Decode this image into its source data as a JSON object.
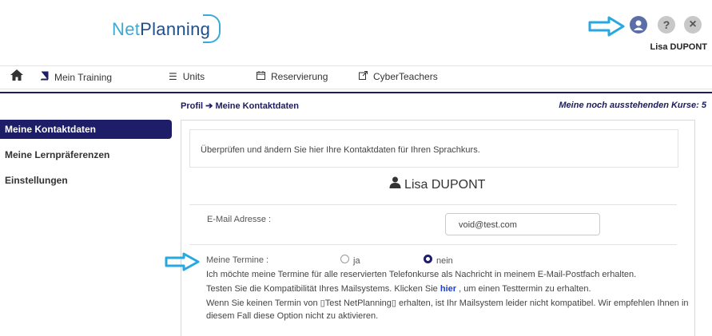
{
  "header": {
    "logo": {
      "part1": "Net",
      "part2": "Planning"
    },
    "username": "Lisa DUPONT",
    "icons": [
      "profile-icon",
      "help-icon",
      "close-icon"
    ]
  },
  "nav": {
    "items": [
      {
        "label": "Mein Training",
        "icon": "book-icon"
      },
      {
        "label": "Units",
        "icon": "list-icon"
      },
      {
        "label": "Reservierung",
        "icon": "calendar-icon"
      },
      {
        "label": "CyberTeachers",
        "icon": "external-link-icon"
      }
    ]
  },
  "breadcrumb": "Profil ➔ Meine Kontaktdaten",
  "pending": "Meine noch ausstehenden Kurse: 5",
  "sidebar": {
    "items": [
      {
        "label": "Meine Kontaktdaten"
      },
      {
        "label": "Meine Lernpräferenzen"
      },
      {
        "label": "Einstellungen"
      }
    ]
  },
  "main": {
    "info": "Überprüfen und ändern Sie hier Ihre Kontaktdaten für Ihren Sprachkurs.",
    "name": "Lisa DUPONT",
    "email_label": "E-Mail Adresse :",
    "email_value": "void@test.com",
    "termine_label": "Meine Termine :",
    "option_ja": "ja",
    "option_nein": "nein",
    "selected": "nein",
    "line1": "Ich möchte meine Termine für alle reservierten Telefonkurse als Nachricht in meinem E-Mail-Postfach erhalten.",
    "line2_pre": "Testen Sie die Kompatibilität Ihres Mailsystems. Klicken Sie ",
    "line2_link": "hier",
    "line2_post": " , um einen Testtermin zu erhalten.",
    "line3": "Wenn Sie keinen Termin von ▯Test NetPlanning▯ erhalten, ist Ihr Mailsystem leider nicht kompatibel. Wir empfehlen Ihnen in",
    "line4": "diesem Fall diese Option nicht zu aktivieren."
  },
  "colors": {
    "accent": "#1e1e68",
    "arrow": "#29a8e0",
    "link": "#1a3fcf"
  }
}
